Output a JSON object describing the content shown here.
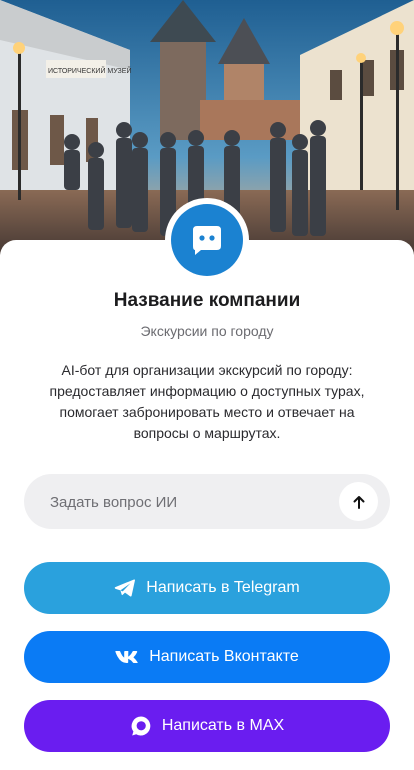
{
  "company": {
    "name": "Название компании",
    "tagline": "Экскурсии по городу",
    "description": "AI-бот для организации экскурсий по городу: предоставляет информацию о доступных турах, помогает забронировать место и отвечает на вопросы о маршрутах."
  },
  "hero": {
    "building_sign": "ИСТОРИЧЕСКИЙ МУЗЕЙ"
  },
  "ask": {
    "placeholder": "Задать вопрос ИИ",
    "value": ""
  },
  "buttons": {
    "telegram": {
      "label": "Написать в Telegram",
      "color": "#2aa1dd",
      "icon": "telegram-icon"
    },
    "vk": {
      "label": "Написать Вконтакте",
      "color": "#0a7bf5",
      "icon": "vk-icon"
    },
    "max": {
      "label": "Написать в MAX",
      "color": "#6a1df0",
      "icon": "max-icon"
    }
  },
  "colors": {
    "avatar": "#1b82d1",
    "input_bg": "#efeff1"
  }
}
